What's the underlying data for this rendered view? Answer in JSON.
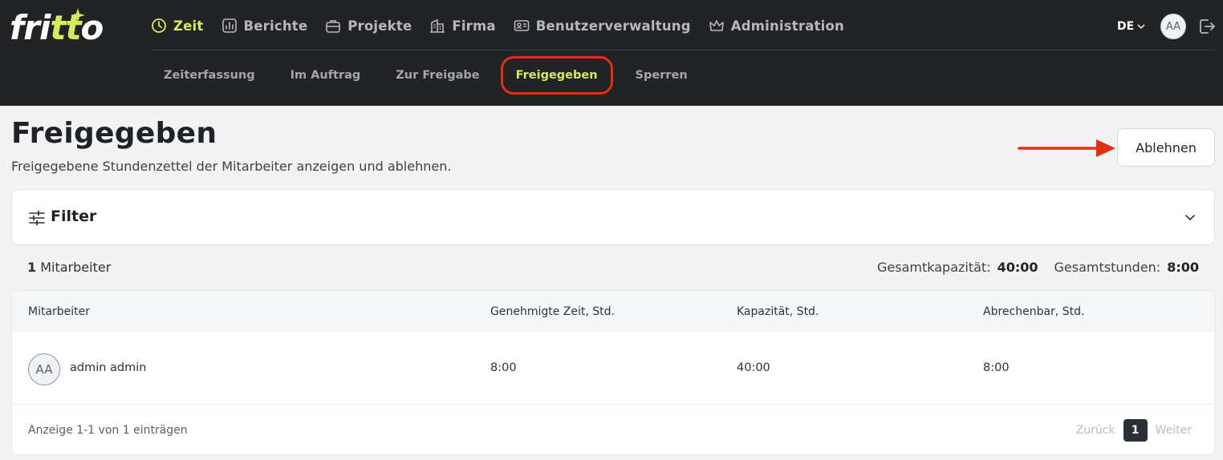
{
  "logo": {
    "text_a": "fri",
    "text_b": "tt",
    "text_c": "o",
    "accent": "#d8ec57"
  },
  "main_nav": [
    {
      "label": "Zeit",
      "icon": "clock-icon",
      "active": true
    },
    {
      "label": "Berichte",
      "icon": "chart-icon",
      "active": false
    },
    {
      "label": "Projekte",
      "icon": "briefcase-icon",
      "active": false
    },
    {
      "label": "Firma",
      "icon": "building-icon",
      "active": false
    },
    {
      "label": "Benutzerverwaltung",
      "icon": "id-card-icon",
      "active": false
    },
    {
      "label": "Administration",
      "icon": "crown-icon",
      "active": false
    }
  ],
  "header_right": {
    "language": "DE",
    "avatar_initials": "AA"
  },
  "sub_nav": [
    {
      "label": "Zeiterfassung",
      "active": false
    },
    {
      "label": "Im Auftrag",
      "active": false
    },
    {
      "label": "Zur Freigabe",
      "active": false
    },
    {
      "label": "Freigegeben",
      "active": true
    },
    {
      "label": "Sperren",
      "active": false
    }
  ],
  "page": {
    "title": "Freigegeben",
    "subtitle": "Freigegebene Stundenzettel der Mitarbeiter anzeigen und ablehnen.",
    "reject_button": "Ablehnen"
  },
  "filter": {
    "label": "Filter"
  },
  "summary": {
    "count": "1",
    "count_label": "Mitarbeiter",
    "capacity_label": "Gesamtkapazität:",
    "capacity_value": "40:00",
    "hours_label": "Gesamtstunden:",
    "hours_value": "8:00"
  },
  "table": {
    "headers": [
      "Mitarbeiter",
      "Genehmigte Zeit, Std.",
      "Kapazität, Std.",
      "Abrechenbar, Std."
    ],
    "rows": [
      {
        "initials": "AA",
        "name": "admin admin",
        "approved": "8:00",
        "capacity": "40:00",
        "billable": "8:00"
      }
    ]
  },
  "pagination": {
    "info": "Anzeige 1-1 von 1 einträgen",
    "prev": "Zurück",
    "current": "1",
    "next": "Weiter"
  },
  "colors": {
    "topbar": "#222325",
    "accent": "#d8ec57",
    "highlight": "#e52d14",
    "background": "#f3f3f4"
  }
}
